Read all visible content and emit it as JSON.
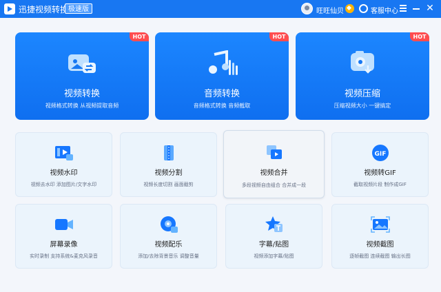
{
  "app": {
    "title": "迅捷视频转换器",
    "edition": "极速版",
    "username": "旺旺仙贝",
    "service": "客服中心",
    "close": "✕"
  },
  "features": [
    {
      "title": "视频转换",
      "desc": "视频格式转换 从视频提取音频",
      "hot": "HOT"
    },
    {
      "title": "音频转换",
      "desc": "音频格式转换 音频截取",
      "hot": "HOT"
    },
    {
      "title": "视频压缩",
      "desc": "压缩视频大小 一键搞定",
      "hot": "HOT"
    }
  ],
  "tools": [
    {
      "title": "视频水印",
      "desc": "视频去水印 添加图片/文字水印"
    },
    {
      "title": "视频分割",
      "desc": "视频长度切割 画面截剪"
    },
    {
      "title": "视频合并",
      "desc": "多段视频自由组合 合并成一段"
    },
    {
      "title": "视频转GIF",
      "desc": "截取视频片段 制作成GIF",
      "gif": "GIF"
    },
    {
      "title": "屏幕录像",
      "desc": "实时录制 支持系统&麦克风录音"
    },
    {
      "title": "视频配乐",
      "desc": "添加/去除背景音乐 调整音量"
    },
    {
      "title": "字幕/贴图",
      "desc": "视频添加字幕/贴图"
    },
    {
      "title": "视频截图",
      "desc": "逐帧截图 连续截图 输出长图"
    }
  ]
}
